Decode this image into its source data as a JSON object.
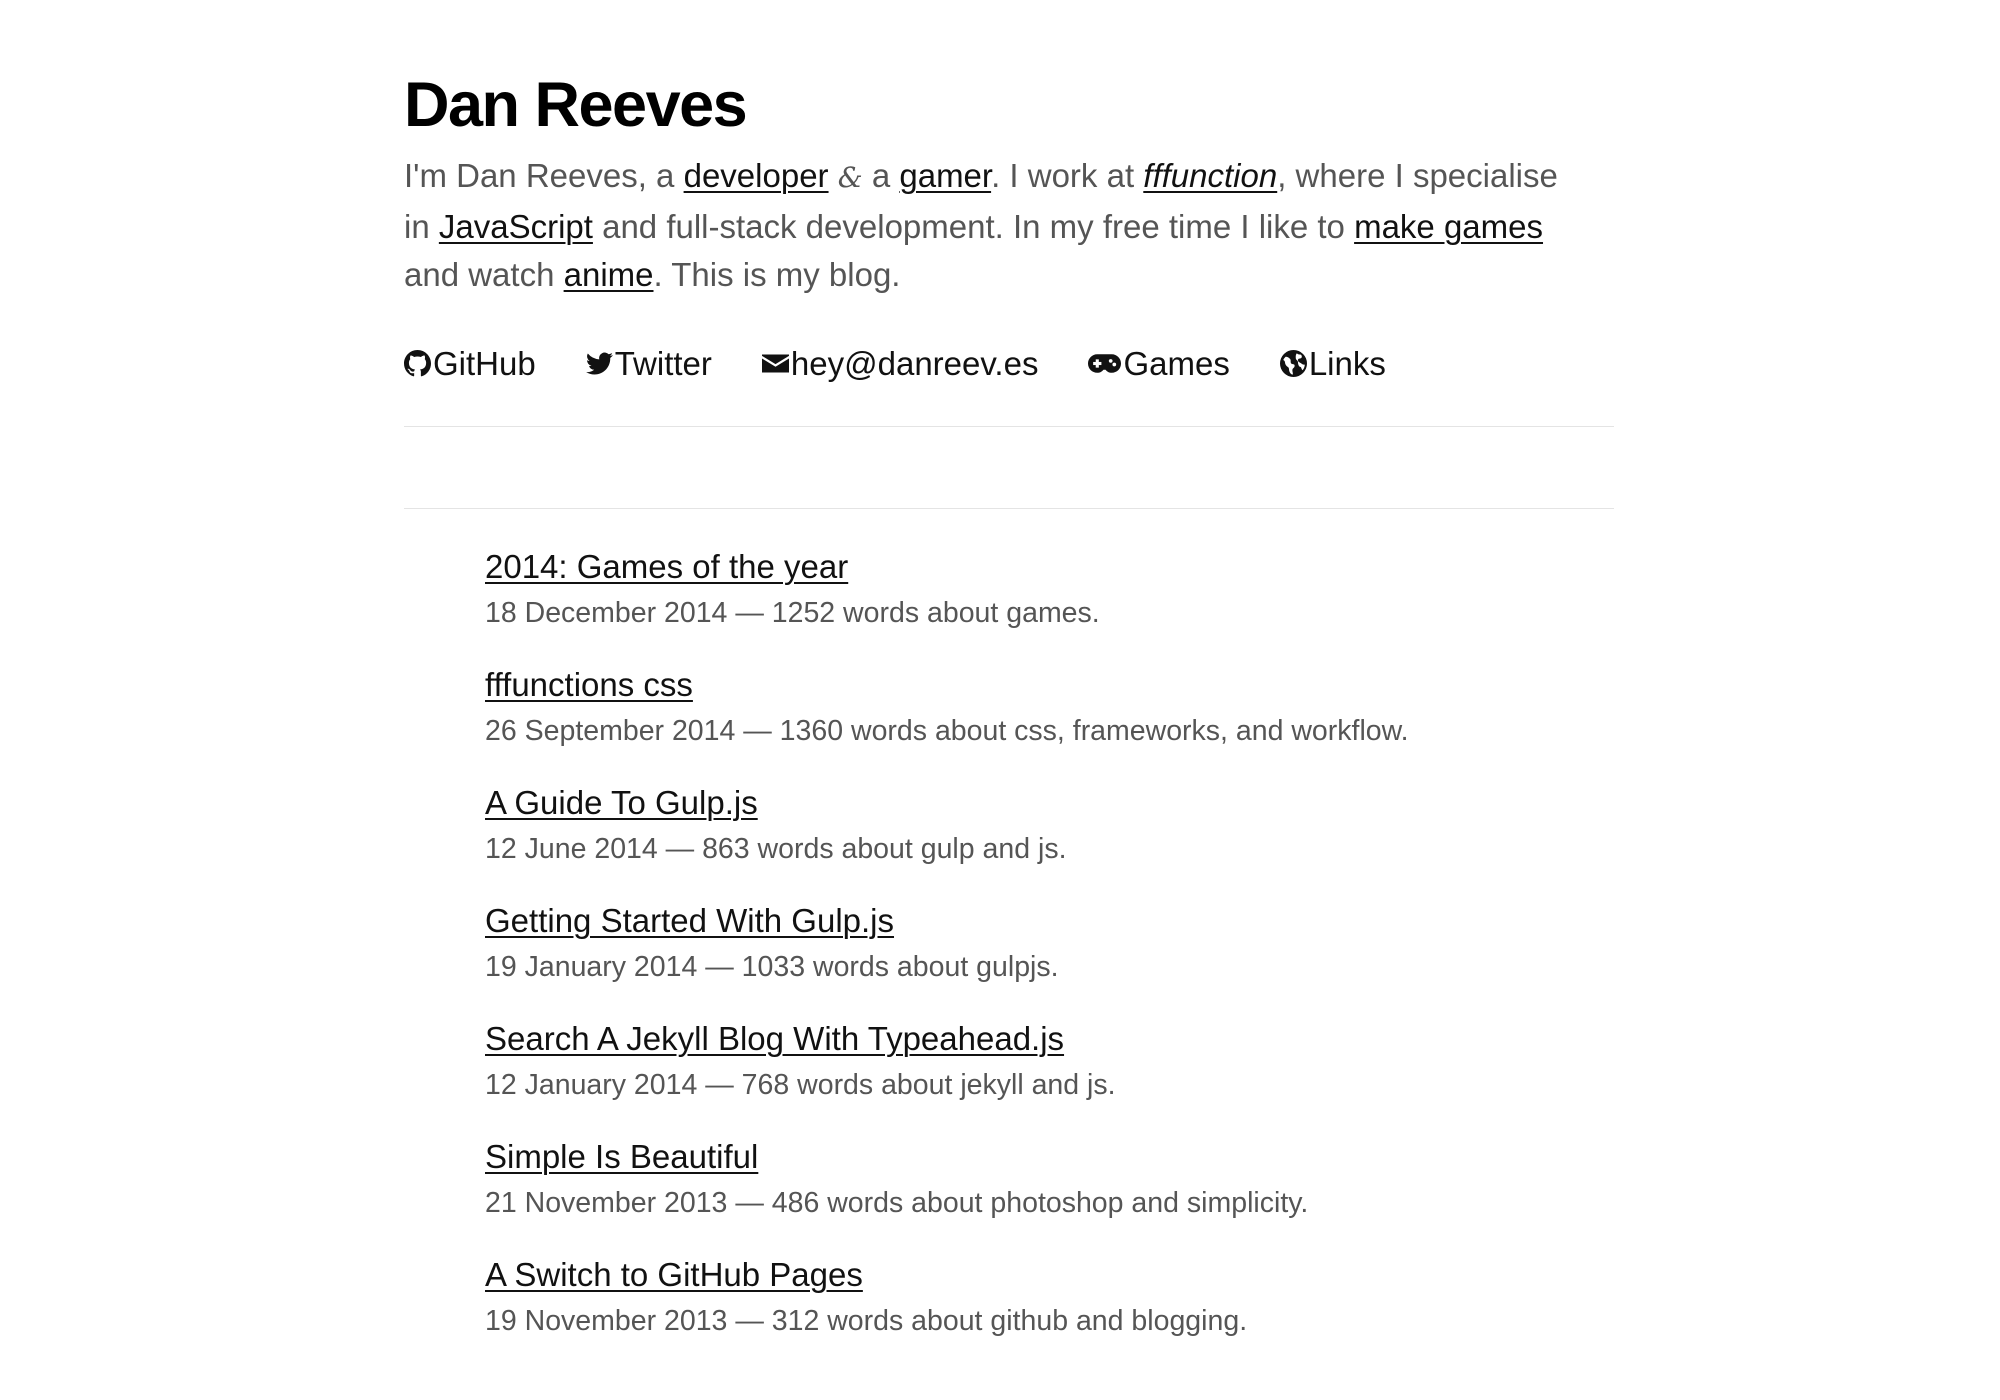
{
  "header": {
    "title": "Dan Reeves",
    "intro": {
      "t1": "I'm Dan Reeves, a ",
      "developer": "developer",
      "amp": "&",
      "t2": " a ",
      "gamer": "gamer",
      "t3": ". I work at ",
      "company": "fffunction",
      "t4": ", where I specialise in ",
      "javascript": "JavaScript",
      "t5": " and full-stack development. In my free time I like to ",
      "make_games": "make games",
      "t6": " and watch ",
      "anime": "anime",
      "t7": ". This is my blog."
    }
  },
  "social": [
    {
      "label": "GitHub",
      "icon": "github-icon"
    },
    {
      "label": "Twitter",
      "icon": "twitter-icon"
    },
    {
      "label": "hey@danreev.es",
      "icon": "envelope-icon"
    },
    {
      "label": "Games",
      "icon": "gamepad-icon"
    },
    {
      "label": "Links",
      "icon": "globe-icon"
    }
  ],
  "posts": [
    {
      "title": "2014: Games of the year",
      "meta": "18 December 2014 — 1252 words about games."
    },
    {
      "title": "fffunctions css",
      "meta": "26 September 2014 — 1360 words about css, frameworks, and workflow."
    },
    {
      "title": "A Guide To Gulp.js",
      "meta": "12 June 2014 — 863 words about gulp and js."
    },
    {
      "title": "Getting Started With Gulp.js",
      "meta": "19 January 2014 — 1033 words about gulpjs."
    },
    {
      "title": "Search A Jekyll Blog With Typeahead.js",
      "meta": "12 January 2014 — 768 words about jekyll and js."
    },
    {
      "title": "Simple Is Beautiful",
      "meta": "21 November 2013 — 486 words about photoshop and simplicity."
    },
    {
      "title": "A Switch to GitHub Pages",
      "meta": "19 November 2013 — 312 words about github and blogging."
    }
  ]
}
